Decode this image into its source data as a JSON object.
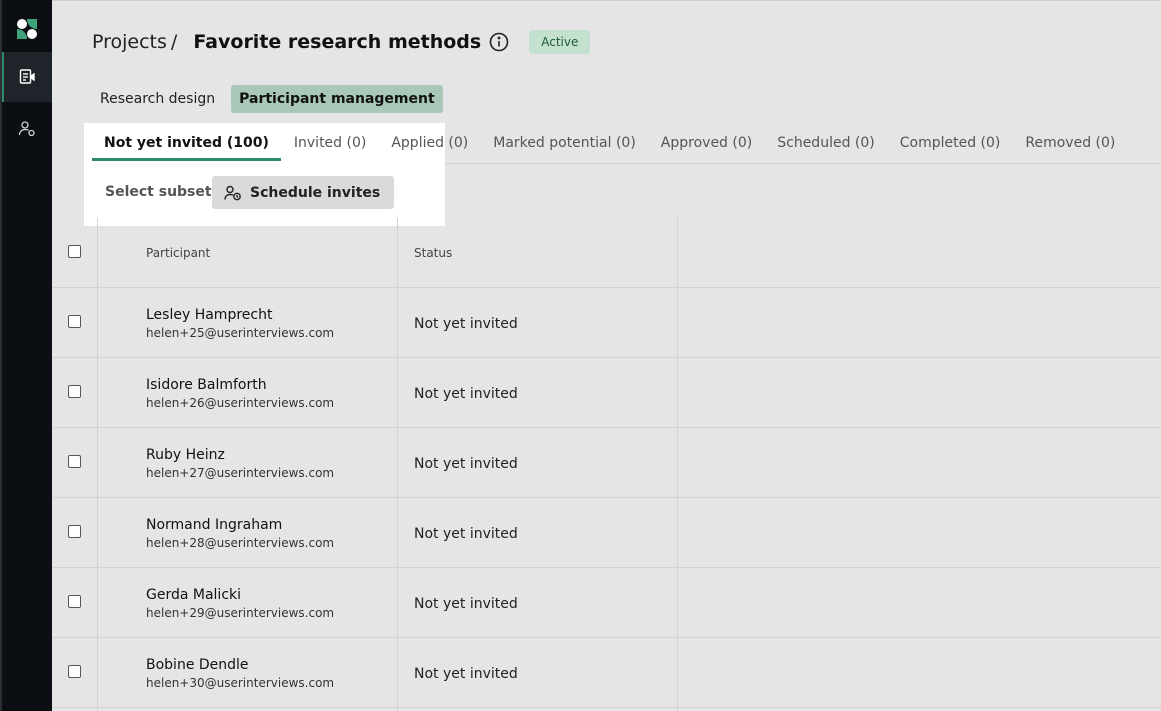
{
  "sidebar": {
    "items": [
      {
        "icon": "logo-icon"
      },
      {
        "icon": "projects-icon",
        "active": true
      },
      {
        "icon": "participants-icon"
      }
    ]
  },
  "header": {
    "breadcrumb": "Projects",
    "separator": "/",
    "title": "Favorite research methods",
    "status_badge": "Active"
  },
  "section_tabs": [
    {
      "label": "Research design",
      "active": false
    },
    {
      "label": "Participant management",
      "active": true
    }
  ],
  "subtabs": [
    {
      "label": "Not yet invited (100)",
      "active": true
    },
    {
      "label": "Invited (0)"
    },
    {
      "label": "Applied (0)"
    },
    {
      "label": "Marked potential (0)"
    },
    {
      "label": "Approved (0)"
    },
    {
      "label": "Scheduled (0)"
    },
    {
      "label": "Completed (0)"
    },
    {
      "label": "Removed (0)"
    }
  ],
  "toolbar": {
    "select_subset": "Select subset",
    "schedule_invites": "Schedule invites"
  },
  "table": {
    "columns": [
      "Participant",
      "Status"
    ],
    "rows": [
      {
        "name": "Lesley Hamprecht",
        "email": "helen+25@userinterviews.com",
        "status": "Not yet invited"
      },
      {
        "name": "Isidore Balmforth",
        "email": "helen+26@userinterviews.com",
        "status": "Not yet invited"
      },
      {
        "name": "Ruby Heinz",
        "email": "helen+27@userinterviews.com",
        "status": "Not yet invited"
      },
      {
        "name": "Normand Ingraham",
        "email": "helen+28@userinterviews.com",
        "status": "Not yet invited"
      },
      {
        "name": "Gerda Malicki",
        "email": "helen+29@userinterviews.com",
        "status": "Not yet invited"
      },
      {
        "name": "Bobine Dendle",
        "email": "helen+30@userinterviews.com",
        "status": "Not yet invited"
      }
    ]
  },
  "colors": {
    "accent": "#2f8a68",
    "sidebar_bg": "#0b0f14",
    "active_badge_bg": "#c4e0cf",
    "active_tab_bg": "#a9c8b8"
  }
}
